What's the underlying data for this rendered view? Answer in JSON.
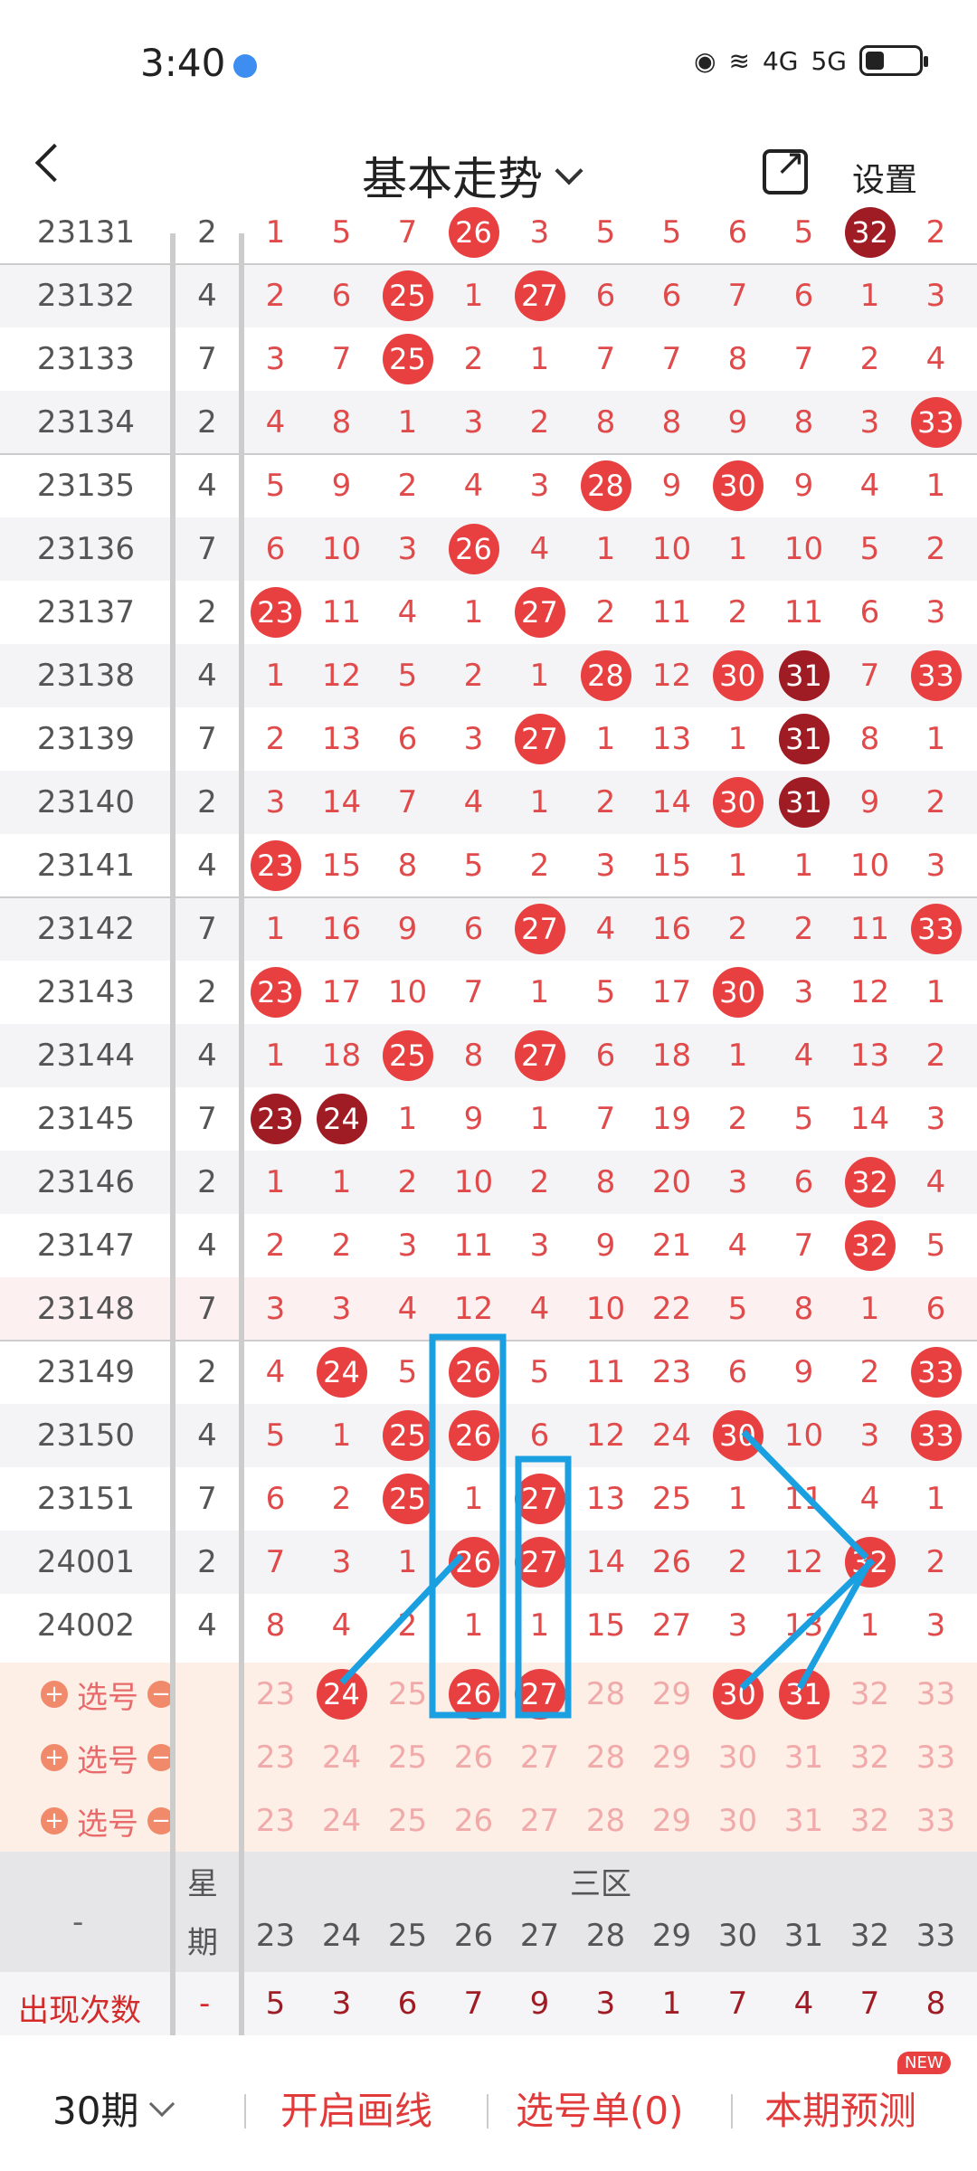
{
  "status": {
    "time": "3:40",
    "net1": "4G",
    "net2": "5G"
  },
  "header": {
    "title": "基本走势",
    "settings": "设置"
  },
  "rows": [
    {
      "p": "23131",
      "w": "2",
      "v": [
        "1",
        "5",
        "7",
        "26",
        "3",
        "5",
        "5",
        "6",
        "5",
        "32",
        "2"
      ],
      "b": [
        3,
        9
      ],
      "d": [
        9
      ]
    },
    {
      "p": "23132",
      "w": "4",
      "v": [
        "2",
        "6",
        "25",
        "1",
        "27",
        "6",
        "6",
        "7",
        "6",
        "1",
        "3"
      ],
      "b": [
        2,
        4
      ],
      "d": []
    },
    {
      "p": "23133",
      "w": "7",
      "v": [
        "3",
        "7",
        "25",
        "2",
        "1",
        "7",
        "7",
        "8",
        "7",
        "2",
        "4"
      ],
      "b": [
        2
      ],
      "d": []
    },
    {
      "p": "23134",
      "w": "2",
      "v": [
        "4",
        "8",
        "1",
        "3",
        "2",
        "8",
        "8",
        "9",
        "8",
        "3",
        "33"
      ],
      "b": [
        10
      ],
      "d": []
    },
    {
      "p": "23135",
      "w": "4",
      "v": [
        "5",
        "9",
        "2",
        "4",
        "3",
        "28",
        "9",
        "30",
        "9",
        "4",
        "1"
      ],
      "b": [
        5,
        7
      ],
      "d": []
    },
    {
      "p": "23136",
      "w": "7",
      "v": [
        "6",
        "10",
        "3",
        "26",
        "4",
        "1",
        "10",
        "1",
        "10",
        "5",
        "2"
      ],
      "b": [
        3
      ],
      "d": []
    },
    {
      "p": "23137",
      "w": "2",
      "v": [
        "23",
        "11",
        "4",
        "1",
        "27",
        "2",
        "11",
        "2",
        "11",
        "6",
        "3"
      ],
      "b": [
        0,
        4
      ],
      "d": []
    },
    {
      "p": "23138",
      "w": "4",
      "v": [
        "1",
        "12",
        "5",
        "2",
        "1",
        "28",
        "12",
        "30",
        "31",
        "7",
        "33"
      ],
      "b": [
        5,
        7,
        8,
        10
      ],
      "d": [
        8
      ]
    },
    {
      "p": "23139",
      "w": "7",
      "v": [
        "2",
        "13",
        "6",
        "3",
        "27",
        "1",
        "13",
        "1",
        "31",
        "8",
        "1"
      ],
      "b": [
        4,
        8
      ],
      "d": [
        8
      ]
    },
    {
      "p": "23140",
      "w": "2",
      "v": [
        "3",
        "14",
        "7",
        "4",
        "1",
        "2",
        "14",
        "30",
        "31",
        "9",
        "2"
      ],
      "b": [
        7,
        8
      ],
      "d": [
        8
      ]
    },
    {
      "p": "23141",
      "w": "4",
      "v": [
        "23",
        "15",
        "8",
        "5",
        "2",
        "3",
        "15",
        "1",
        "1",
        "10",
        "3"
      ],
      "b": [
        0
      ],
      "d": []
    },
    {
      "p": "23142",
      "w": "7",
      "v": [
        "1",
        "16",
        "9",
        "6",
        "27",
        "4",
        "16",
        "2",
        "2",
        "11",
        "33"
      ],
      "b": [
        4,
        10
      ],
      "d": []
    },
    {
      "p": "23143",
      "w": "2",
      "v": [
        "23",
        "17",
        "10",
        "7",
        "1",
        "5",
        "17",
        "30",
        "3",
        "12",
        "1"
      ],
      "b": [
        0,
        7
      ],
      "d": []
    },
    {
      "p": "23144",
      "w": "4",
      "v": [
        "1",
        "18",
        "25",
        "8",
        "27",
        "6",
        "18",
        "1",
        "4",
        "13",
        "2"
      ],
      "b": [
        2,
        4
      ],
      "d": []
    },
    {
      "p": "23145",
      "w": "7",
      "v": [
        "23",
        "24",
        "1",
        "9",
        "1",
        "7",
        "19",
        "2",
        "5",
        "14",
        "3"
      ],
      "b": [
        0,
        1
      ],
      "d": [
        0,
        1
      ]
    },
    {
      "p": "23146",
      "w": "2",
      "v": [
        "1",
        "1",
        "2",
        "10",
        "2",
        "8",
        "20",
        "3",
        "6",
        "32",
        "4"
      ],
      "b": [
        9
      ],
      "d": []
    },
    {
      "p": "23147",
      "w": "4",
      "v": [
        "2",
        "2",
        "3",
        "11",
        "3",
        "9",
        "21",
        "4",
        "7",
        "32",
        "5"
      ],
      "b": [
        9
      ],
      "d": []
    },
    {
      "p": "23148",
      "w": "7",
      "v": [
        "3",
        "3",
        "4",
        "12",
        "4",
        "10",
        "22",
        "5",
        "8",
        "1",
        "6"
      ],
      "b": [],
      "d": []
    },
    {
      "p": "23149",
      "w": "2",
      "v": [
        "4",
        "24",
        "5",
        "26",
        "5",
        "11",
        "23",
        "6",
        "9",
        "2",
        "33"
      ],
      "b": [
        1,
        3,
        10
      ],
      "d": []
    },
    {
      "p": "23150",
      "w": "4",
      "v": [
        "5",
        "1",
        "25",
        "26",
        "6",
        "12",
        "24",
        "30",
        "10",
        "3",
        "33"
      ],
      "b": [
        2,
        3,
        7,
        10
      ],
      "d": []
    },
    {
      "p": "23151",
      "w": "7",
      "v": [
        "6",
        "2",
        "25",
        "1",
        "27",
        "13",
        "25",
        "1",
        "11",
        "4",
        "1"
      ],
      "b": [
        2,
        4
      ],
      "d": []
    },
    {
      "p": "24001",
      "w": "2",
      "v": [
        "7",
        "3",
        "1",
        "26",
        "27",
        "14",
        "26",
        "2",
        "12",
        "32",
        "2"
      ],
      "b": [
        3,
        4,
        9
      ],
      "d": []
    },
    {
      "p": "24002",
      "w": "4",
      "v": [
        "8",
        "4",
        "2",
        "1",
        "1",
        "15",
        "27",
        "3",
        "13",
        "1",
        "3"
      ],
      "b": [],
      "d": []
    }
  ],
  "pick": {
    "label": "选号",
    "rows": [
      {
        "v": [
          "23",
          "24",
          "25",
          "26",
          "27",
          "28",
          "29",
          "30",
          "31",
          "32",
          "33"
        ],
        "b": [
          1,
          3,
          4,
          7,
          8
        ]
      },
      {
        "v": [
          "23",
          "24",
          "25",
          "26",
          "27",
          "28",
          "29",
          "30",
          "31",
          "32",
          "33"
        ],
        "b": []
      },
      {
        "v": [
          "23",
          "24",
          "25",
          "26",
          "27",
          "28",
          "29",
          "30",
          "31",
          "32",
          "33"
        ],
        "b": []
      }
    ]
  },
  "footer": {
    "dash": "-",
    "week1": "星",
    "week2": "期",
    "zone": "三区",
    "cols": [
      "23",
      "24",
      "25",
      "26",
      "27",
      "28",
      "29",
      "30",
      "31",
      "32",
      "33"
    ],
    "count_label": "出现次数",
    "count_dash": "-",
    "counts": [
      "5",
      "3",
      "6",
      "7",
      "9",
      "3",
      "1",
      "7",
      "4",
      "7",
      "8"
    ]
  },
  "bottom": {
    "periods": "30期",
    "draw": "开启画线",
    "list": "选号单(0)",
    "predict": "本期预测",
    "new": "NEW"
  }
}
